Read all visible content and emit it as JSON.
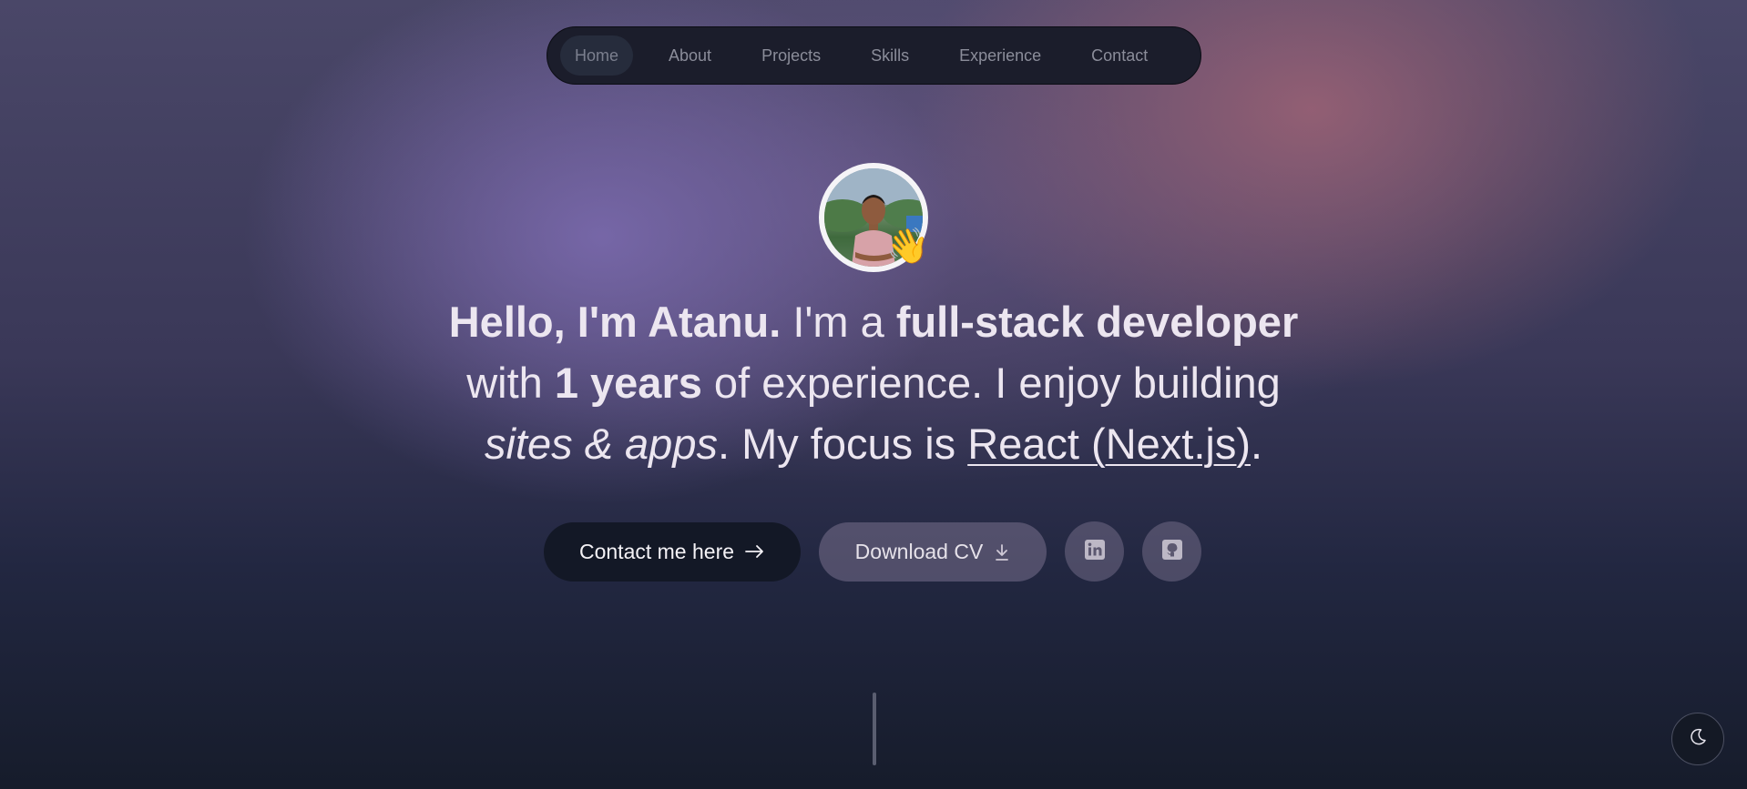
{
  "nav": {
    "items": [
      {
        "label": "Home",
        "active": true
      },
      {
        "label": "About"
      },
      {
        "label": "Projects"
      },
      {
        "label": "Skills"
      },
      {
        "label": "Experience"
      },
      {
        "label": "Contact"
      }
    ]
  },
  "hero": {
    "avatar_icon": "profile-photo",
    "wave_emoji": "👋",
    "intro_bold": "Hello, I'm Atanu.",
    "text_1": " I'm a ",
    "role_bold": "full-stack developer",
    "text_2": " with ",
    "years_bold": "1 years",
    "text_3": " of experience. I enjoy building ",
    "sites_italic": "sites & apps",
    "text_4": ". My focus is ",
    "focus_link": "React (Next.js)",
    "text_5": "."
  },
  "actions": {
    "contact_label": "Contact me here",
    "contact_icon": "arrow-right-icon",
    "cv_label": "Download CV",
    "cv_icon": "download-icon",
    "linkedin_icon": "linkedin-icon",
    "github_icon": "github-icon"
  },
  "theme": {
    "toggle_icon": "moon-icon"
  },
  "colors": {
    "nav_bg": "#1b1d2b",
    "primary_button": "#131826",
    "text": "#ece6f0"
  }
}
